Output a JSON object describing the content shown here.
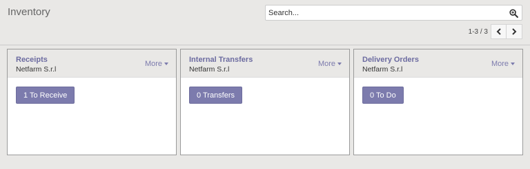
{
  "header": {
    "title": "Inventory",
    "search_placeholder": "Search...",
    "search_icon": "magnifier-icon",
    "pager": {
      "value": "1-3 / 3",
      "prev_icon": "chevron-left-icon",
      "next_icon": "chevron-right-icon"
    }
  },
  "cards": [
    {
      "title": "Receipts",
      "company": "Netfarm S.r.l",
      "more_label": "More",
      "action_label": "1 To Receive"
    },
    {
      "title": "Internal Transfers",
      "company": "Netfarm S.r.l",
      "more_label": "More",
      "action_label": "0 Transfers"
    },
    {
      "title": "Delivery Orders",
      "company": "Netfarm S.r.l",
      "more_label": "More",
      "action_label": "0 To Do"
    }
  ],
  "colors": {
    "accent": "#7c7bad",
    "title": "#6c6ba0",
    "background": "#e9e8e6"
  }
}
